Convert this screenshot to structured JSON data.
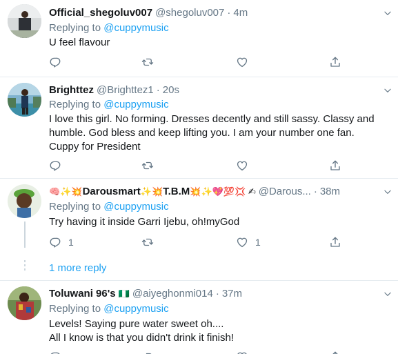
{
  "replying_label": "Replying to",
  "tweets": [
    {
      "name": "Official_shegoluv007",
      "handle": "@shegoluv007",
      "time": "4m",
      "mention": "@cuppymusic",
      "text": "U feel flavour",
      "reply_count": "",
      "like_count": ""
    },
    {
      "name": "Brighttez",
      "handle": "@Brighttez1",
      "time": "20s",
      "mention": "@cuppymusic",
      "text": "I love this girl. No forming. Dresses decently and still sassy. Classy and humble. God bless and keep lifting you. I am your number one fan. Cuppy for President",
      "reply_count": "",
      "like_count": ""
    },
    {
      "name_prefix_emoji": "🧠✨💥",
      "name": "Darousmart",
      "name_mid_emoji": "✨💥",
      "name2": "T.B.M",
      "name_suffix_emoji": "💥✨💖💯💢 ✍",
      "handle": "@Darous...",
      "time": "38m",
      "mention": "@cuppymusic",
      "text": "Try having it inside Garri Ijebu, oh!myGod",
      "reply_count": "1",
      "like_count": "1"
    },
    {
      "name": "Toluwani 96's",
      "flag": "🇳🇬",
      "handle": "@aiyeghonmi014",
      "time": "37m",
      "mention": "@cuppymusic",
      "text_line1": "Levels! Saying pure water sweet oh....",
      "text_line2": "All I know is that you didn't drink it finish!"
    }
  ],
  "more_replies": "1 more reply",
  "icons": {
    "reply": "reply-icon",
    "retweet": "retweet-icon",
    "like": "heart-icon",
    "share": "share-icon",
    "caret": "chevron-down-icon"
  },
  "colors": {
    "accent": "#1da1f2",
    "muted": "#657786",
    "text": "#14171a",
    "separator": "#e6ecf0"
  }
}
